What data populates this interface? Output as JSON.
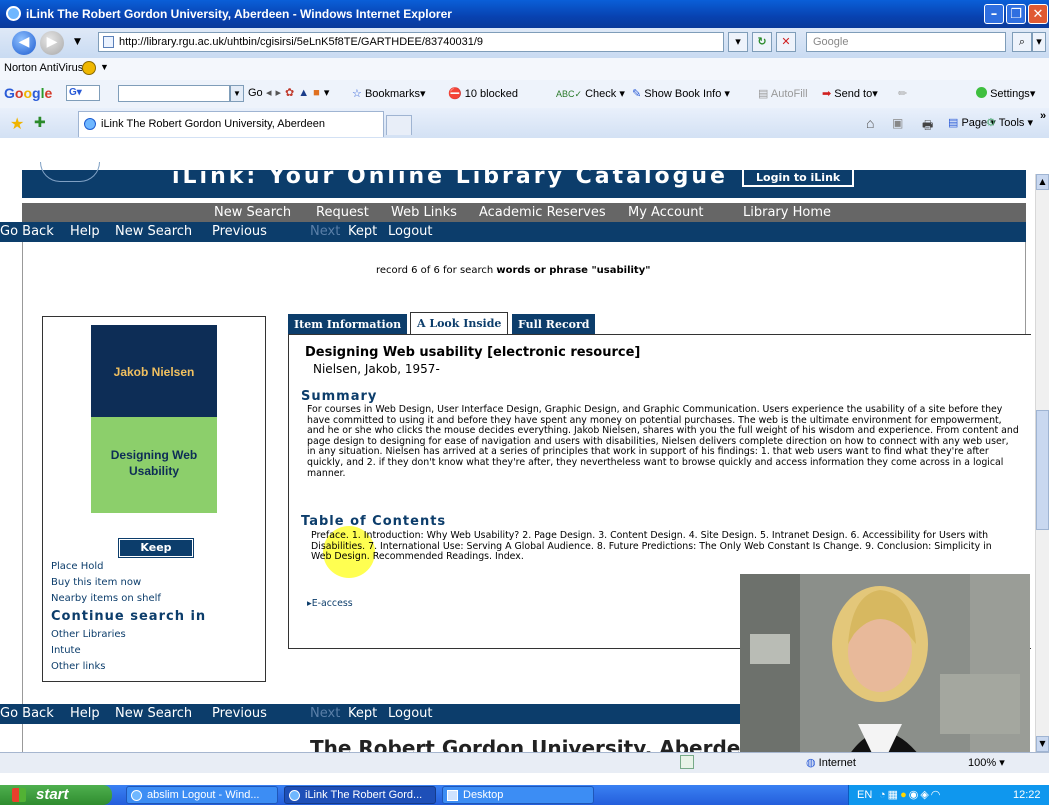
{
  "window": {
    "title": "iLink The Robert Gordon University, Aberdeen - Windows Internet Explorer"
  },
  "address": {
    "url": "http://library.rgu.ac.uk/uhtbin/cgisirsi/5eLnK5f8TE/GARTHDEE/83740031/9",
    "search_placeholder": "Google"
  },
  "norton": {
    "label": "Norton AntiVirus"
  },
  "google_toolbar": {
    "go": "Go",
    "bookmarks": "Bookmarks",
    "blocked": "10 blocked",
    "check": "Check",
    "show_book_info": "Show Book Info",
    "autofill": "AutoFill",
    "send_to": "Send to",
    "settings": "Settings"
  },
  "tab": {
    "title": "iLink The Robert Gordon University, Aberdeen",
    "page": "Page",
    "tools": "Tools"
  },
  "page": {
    "banner_title": "iLink: Your Online Library Catalogue",
    "login": "Login to iLink",
    "top_nav": [
      "New Search",
      "Request",
      "Web Links",
      "Academic Reserves",
      "My Account",
      "Library Home"
    ],
    "sub_nav": {
      "go_back": "Go Back",
      "help": "Help",
      "new_search": "New Search",
      "previous": "Previous",
      "next": "Next",
      "kept": "Kept",
      "logout": "Logout"
    },
    "record_prefix": "record 6 of 6 for search",
    "record_query": "words or phrase \"usability\"",
    "book": {
      "author_cover": "Jakob Nielsen",
      "title_cover": "Designing Web Usability"
    },
    "keep": "Keep",
    "left_links": [
      "Place Hold",
      "Buy this item now",
      "Nearby items on shelf"
    ],
    "continue_heading": "Continue search in",
    "continue_links": [
      "Other Libraries",
      "Intute",
      "Other links"
    ],
    "tabs": {
      "item_info": "Item Information",
      "look_inside": "A Look Inside",
      "full_record": "Full Record"
    },
    "title": "Designing Web usability [electronic resource]",
    "author": "Nielsen, Jakob, 1957-",
    "summary_heading": "Summary",
    "summary": "For courses in Web Design, User Interface Design, Graphic Design, and Graphic Communication. Users experience the usability of a site before they have committed to using it and before they have spent any money on potential purchases. The web is the ultimate environment for empowerment, and he or she who clicks the mouse decides everything. Jakob Nielsen, shares with you the full weight of his wisdom and experience. From content and page design to designing for ease of navigation and users with disabilities, Nielsen delivers complete direction on how to connect with any web user, in any situation. Nielsen has arrived at a series of principles that work in support of his findings: 1. that web users want to find what they're after quickly, and 2. if they don't know what they're after, they nevertheless want to browse quickly and access information they come across in a logical manner.",
    "toc_heading": "Table of Contents",
    "toc": "Preface. 1. Introduction: Why Web Usability? 2. Page Design. 3. Content Design. 4. Site Design. 5. Intranet Design. 6. Accessibility for Users with Disabilities. 7. International Use: Serving A Global Audience. 8. Future Predictions: The Only Web Constant Is Change. 9. Conclusion: Simplicity in Web Design. Recommended Readings. Index.",
    "eaccess": "E-access",
    "footer": "The Robert Gordon University, Aberdeen"
  },
  "status": {
    "zone": "Internet",
    "zoom": "100%"
  },
  "taskbar": {
    "start": "start",
    "items": [
      "abslim Logout - Wind...",
      "iLink The Robert Gord...",
      "Desktop"
    ],
    "lang": "EN",
    "time": "12:22"
  },
  "colors": {
    "navy": "#0c3d6b",
    "grey_nav": "#666666",
    "book_top": "#0d2d56",
    "book_bottom": "#8ccf6b",
    "highlight": "#ffff33"
  }
}
